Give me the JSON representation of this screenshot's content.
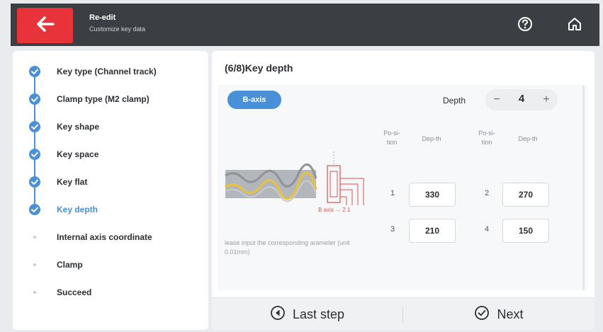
{
  "header": {
    "title": "Re-edit",
    "subtitle": "Customize key data",
    "back_icon": "arrow-left-icon",
    "help_icon": "help-icon",
    "home_icon": "home-icon",
    "accent": "#e8333a",
    "bar_color": "#3b3e42"
  },
  "sidebar": {
    "steps": [
      {
        "label": "Key type (Channel track)",
        "state": "done"
      },
      {
        "label": "Clamp type (M2 clamp)",
        "state": "done"
      },
      {
        "label": "Key shape",
        "state": "done"
      },
      {
        "label": "Key space",
        "state": "done"
      },
      {
        "label": "Key flat",
        "state": "done"
      },
      {
        "label": "Key depth",
        "state": "active"
      },
      {
        "label": "Internal axis coordinate",
        "state": "pending"
      },
      {
        "label": "Clamp",
        "state": "pending"
      },
      {
        "label": "Succeed",
        "state": "pending"
      }
    ],
    "accent": "#4a90d9"
  },
  "main": {
    "title": "(6/8)Key depth",
    "axis_button": "B-axis",
    "depth_label": "Depth",
    "depth_value": "4",
    "hint": "lease input the corresponding arameter (unit 0.01mm)",
    "diagram_label": "B axis → 2 1",
    "table": {
      "headers": [
        "Po-si-tion",
        "Dep-th",
        "Po-si-tion",
        "Dep-th"
      ],
      "rows": [
        {
          "pos1": "1",
          "depth1": "330",
          "pos2": "2",
          "depth2": "270"
        },
        {
          "pos1": "3",
          "depth1": "210",
          "pos2": "4",
          "depth2": "150"
        }
      ]
    }
  },
  "footer": {
    "last_step": "Last step",
    "next": "Next",
    "last_icon": "circle-left-icon",
    "next_icon": "circle-check-icon"
  }
}
